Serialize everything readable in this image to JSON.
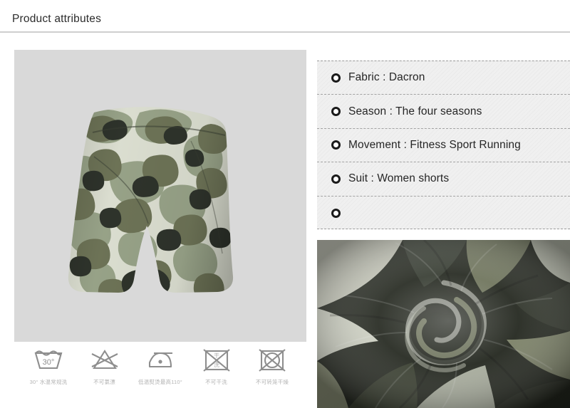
{
  "header": {
    "title": "Product attributes"
  },
  "attributes": {
    "rows": [
      {
        "bullet": "ring-bullet-icon",
        "text": "Fabric : Dacron"
      },
      {
        "bullet": "ring-bullet-icon",
        "text": "Season : The four seasons"
      },
      {
        "bullet": "ring-bullet-icon",
        "text": "Movement : Fitness Sport Running"
      },
      {
        "bullet": "ring-bullet-icon",
        "text": "Suit : Women shorts"
      },
      {
        "bullet": "ring-bullet-icon",
        "text": ""
      }
    ]
  },
  "product_photo": {
    "alt": "Camouflage women high-waist sport shorts"
  },
  "fabric_photo": {
    "alt": "Camouflage fabric close-up swirl"
  },
  "care_instructions": [
    {
      "icon": "wash-tub-30-icon",
      "caption": "30° 水温常规洗"
    },
    {
      "icon": "no-bleach-icon",
      "caption": "不可氯漂"
    },
    {
      "icon": "iron-low-temp-icon",
      "caption": "低温熨烫最高110°"
    },
    {
      "icon": "no-dry-clean-icon",
      "caption": "不可干洗"
    },
    {
      "icon": "no-tumble-dry-icon",
      "caption": "不可转笼干燥"
    }
  ],
  "colors": {
    "panel_background": "#d9d9d9",
    "attributes_background": "#f0f0f0",
    "divider": "#cfcfcf",
    "title_text": "#2b2b2b",
    "attribute_text": "#262626",
    "care_icon": "#8e8e8e",
    "care_caption": "#b4b4b4",
    "camo_dark": "#2f342c",
    "camo_olive": "#6f7558",
    "camo_sage": "#9aa58a",
    "camo_cream": "#dfe2d4"
  }
}
